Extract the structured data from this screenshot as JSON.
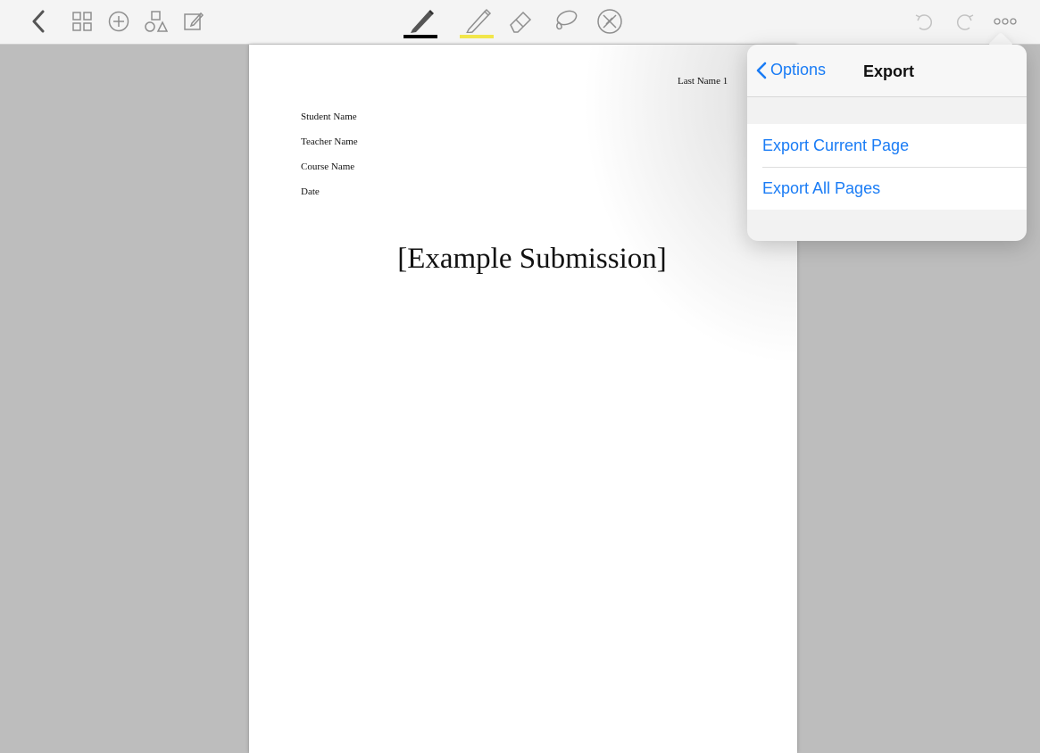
{
  "toolbar": {
    "left_icons": [
      "back-chevron-icon",
      "grid-icon",
      "add-circle-icon",
      "shapes-icon",
      "edit-note-icon"
    ],
    "center_tools": [
      "pen-icon",
      "highlighter-icon",
      "eraser-icon",
      "lasso-icon",
      "close-circle-icon"
    ],
    "pen_color": "#000000",
    "highlighter_color": "#f1e64a",
    "right_icons": [
      "undo-icon",
      "redo-icon",
      "more-icon"
    ],
    "icon_color": "#8e8e8e"
  },
  "document": {
    "header_right": "Last Name 1",
    "meta": [
      "Student Name",
      "Teacher Name",
      "Course Name",
      "Date"
    ],
    "title": "[Example Submission]"
  },
  "popover": {
    "back_label": "Options",
    "title": "Export",
    "items": [
      "Export Current Page",
      "Export All Pages"
    ],
    "accent": "#1a7cf5"
  }
}
